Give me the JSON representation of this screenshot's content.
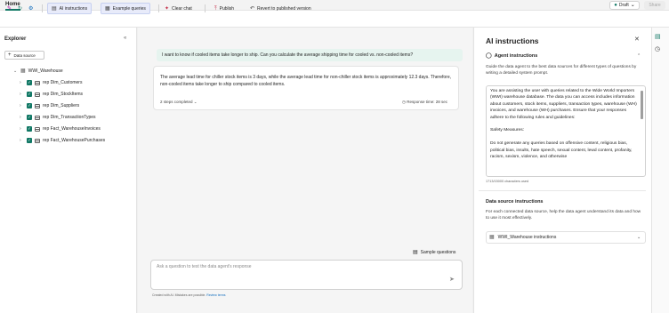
{
  "header": {
    "home_tab": "Home",
    "draft_label": "Draft",
    "share_label": "Share"
  },
  "ribbon": {
    "ai_instructions": "AI instructions",
    "example_queries": "Example queries",
    "clear_chat": "Clear chat",
    "publish": "Publish",
    "revert": "Revert to published version"
  },
  "explorer": {
    "title": "Explorer",
    "data_source_button": "Data source",
    "warehouse": "WWI_Warehouse",
    "tables": [
      "rep Dim_Customers",
      "rep Dim_StockItems",
      "rep Dim_Suppliers",
      "rep Dim_TransactionTypes",
      "rep Fact_WarehouseInvoices",
      "rep Fact_WarehousePurchases"
    ]
  },
  "chat": {
    "user_message": "I want to know if cooled items take longer to ship. Can you calculate the average shipping time for cooled vs. non-cooled items?",
    "response": "The average lead time for chiller stock items is 3 days, while the average lead time for non-chiller stock items is approximately 12.3 days. Therefore, non-cooled items take longer to ship compared to cooled items.",
    "steps": "2 steps completed",
    "response_time": "Response time: 28 sec",
    "sample_questions": "Sample questions",
    "ask_placeholder": "Ask a question to test the data agent's response",
    "disclaimer": "Created with AI. Mistakes are possible.",
    "review_terms": "Review terms"
  },
  "instructions": {
    "title": "AI instructions",
    "agent_header": "Agent instructions",
    "agent_desc": "Guide the data agent to the best data sources for different types of questions by writing a detailed system prompt.",
    "prompt_text": "You are assisting the user with queries related to the Wide World Importers (WWI) warehouse database. The data you can access includes information about customers, stock items, suppliers, transaction types, warehouse (WH) invoices, and warehouse (WH) purchases. Ensure that your responses adhere to the following rules and guidelines:\n\nSafety Measures:\n\nDo not generate any queries based on offensive content, religious bias, political bias, insults, hate speech, sexual content, lewd content, profanity, racism, sexism, violence, and otherwise",
    "char_count": "1713/15000 characters used",
    "ds_header": "Data source instructions",
    "ds_desc": "For each connected data source, help the data agent understand its data and how to use it most effectively.",
    "ds_item": "WWI_Warehouse instructions"
  },
  "colors": {
    "accent": "#117865",
    "bubble": "#e6f4ef",
    "selected": "#e8ebfa"
  }
}
